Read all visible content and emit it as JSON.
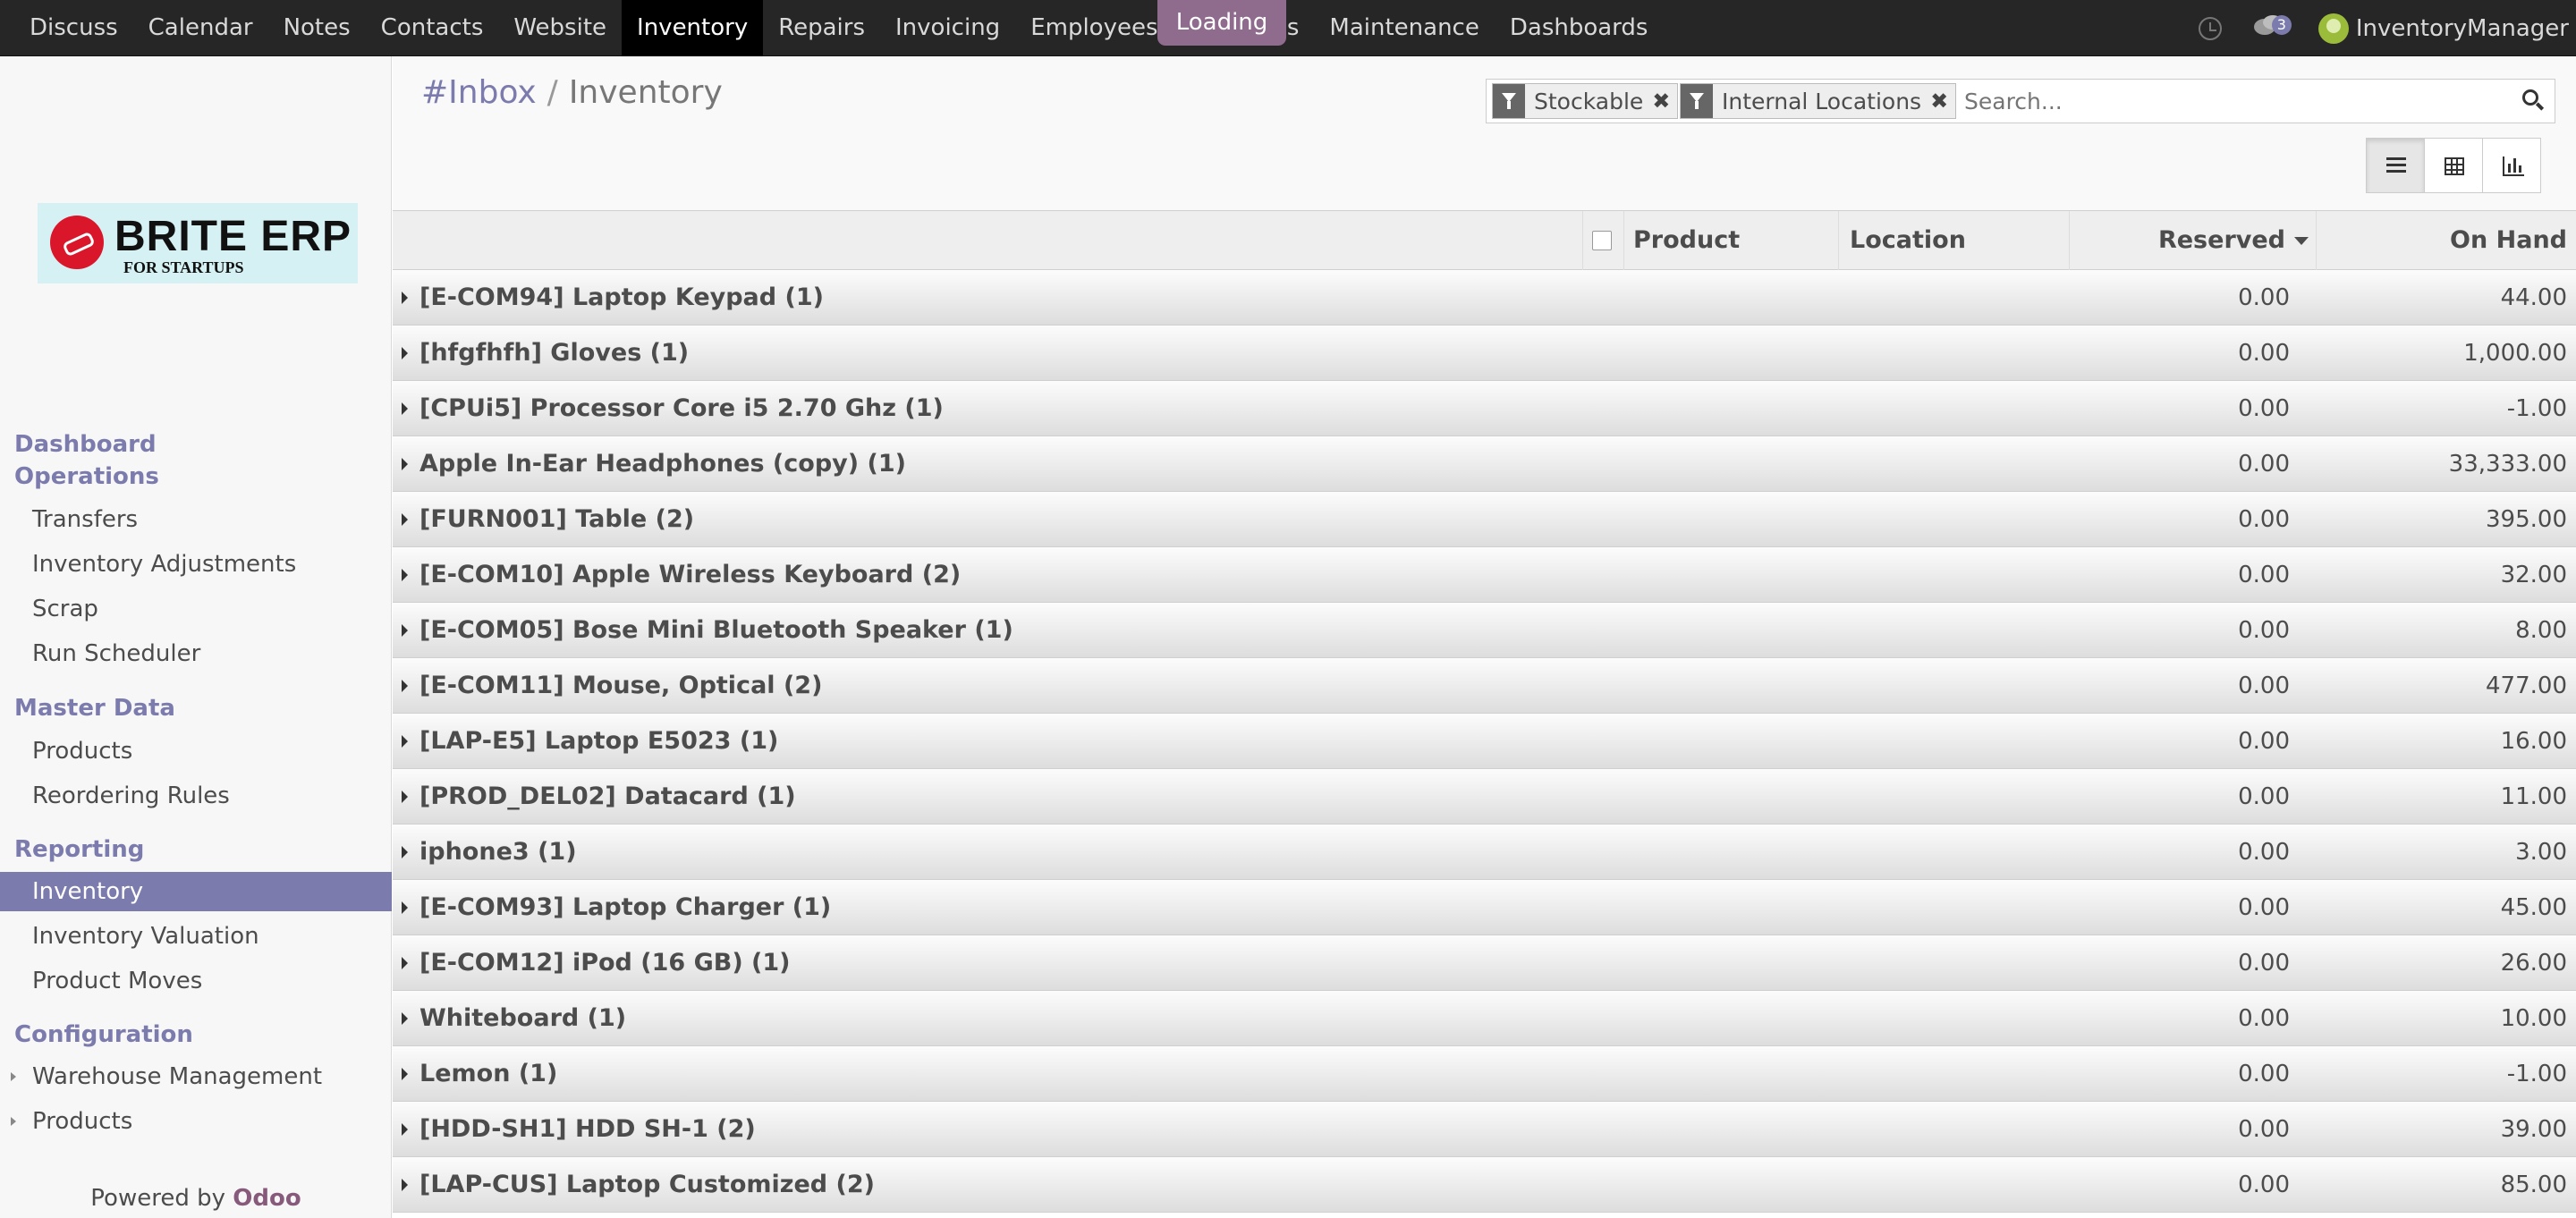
{
  "topbar": {
    "menu": [
      "Discuss",
      "Calendar",
      "Notes",
      "Contacts",
      "Website",
      "Inventory",
      "Repairs",
      "Invoicing",
      "Employees",
      "Expenses",
      "Maintenance",
      "Dashboards"
    ],
    "loading_label": "Loading",
    "chat_count": "3",
    "user_name": "InventoryManager"
  },
  "logo": {
    "title": "BRITE ERP",
    "subtitle": "FOR STARTUPS"
  },
  "sidebar": {
    "sections": [
      {
        "title_line1": "Dashboard",
        "title_line2": "Operations",
        "items": [
          "Transfers",
          "Inventory Adjustments",
          "Scrap",
          "Run Scheduler"
        ]
      },
      {
        "title": "Master Data",
        "items": [
          "Products",
          "Reordering Rules"
        ]
      },
      {
        "title": "Reporting",
        "items": [
          "Inventory",
          "Inventory Valuation",
          "Product Moves"
        ]
      },
      {
        "title": "Configuration",
        "items": [
          "Warehouse Management",
          "Products"
        ]
      }
    ],
    "powered_by": "Powered by",
    "powered_brand": "Odoo"
  },
  "breadcrumb": {
    "parent": "#Inbox",
    "separator": "/",
    "current": "Inventory"
  },
  "search": {
    "facets": [
      "Stockable",
      "Internal Locations"
    ],
    "placeholder": "Search..."
  },
  "table": {
    "columns": {
      "product": "Product",
      "location": "Location",
      "reserved": "Reserved",
      "on_hand": "On Hand"
    },
    "rows": [
      {
        "name": "[E-COM94] Laptop Keypad (1)",
        "reserved": "0.00",
        "on_hand": "44.00"
      },
      {
        "name": "[hfgfhfh] Gloves (1)",
        "reserved": "0.00",
        "on_hand": "1,000.00"
      },
      {
        "name": "[CPUi5] Processor Core i5 2.70 Ghz (1)",
        "reserved": "0.00",
        "on_hand": "-1.00"
      },
      {
        "name": "Apple In-Ear Headphones (copy) (1)",
        "reserved": "0.00",
        "on_hand": "33,333.00"
      },
      {
        "name": "[FURN001] Table (2)",
        "reserved": "0.00",
        "on_hand": "395.00"
      },
      {
        "name": "[E-COM10] Apple Wireless Keyboard (2)",
        "reserved": "0.00",
        "on_hand": "32.00"
      },
      {
        "name": "[E-COM05] Bose Mini Bluetooth Speaker (1)",
        "reserved": "0.00",
        "on_hand": "8.00"
      },
      {
        "name": "[E-COM11] Mouse, Optical (2)",
        "reserved": "0.00",
        "on_hand": "477.00"
      },
      {
        "name": "[LAP-E5] Laptop E5023 (1)",
        "reserved": "0.00",
        "on_hand": "16.00"
      },
      {
        "name": "[PROD_DEL02] Datacard (1)",
        "reserved": "0.00",
        "on_hand": "11.00"
      },
      {
        "name": "iphone3 (1)",
        "reserved": "0.00",
        "on_hand": "3.00"
      },
      {
        "name": "[E-COM93] Laptop Charger (1)",
        "reserved": "0.00",
        "on_hand": "45.00"
      },
      {
        "name": "[E-COM12] iPod (16 GB) (1)",
        "reserved": "0.00",
        "on_hand": "26.00"
      },
      {
        "name": "Whiteboard (1)",
        "reserved": "0.00",
        "on_hand": "10.00"
      },
      {
        "name": "Lemon (1)",
        "reserved": "0.00",
        "on_hand": "-1.00"
      },
      {
        "name": "[HDD-SH1] HDD SH-1 (2)",
        "reserved": "0.00",
        "on_hand": "39.00"
      },
      {
        "name": "[LAP-CUS] Laptop Customized (2)",
        "reserved": "0.00",
        "on_hand": "85.00"
      }
    ]
  },
  "colors": {
    "topbar": "#262626",
    "accent": "#7c7bad",
    "loading": "#8f6b8e",
    "odoo": "#875a7b"
  }
}
